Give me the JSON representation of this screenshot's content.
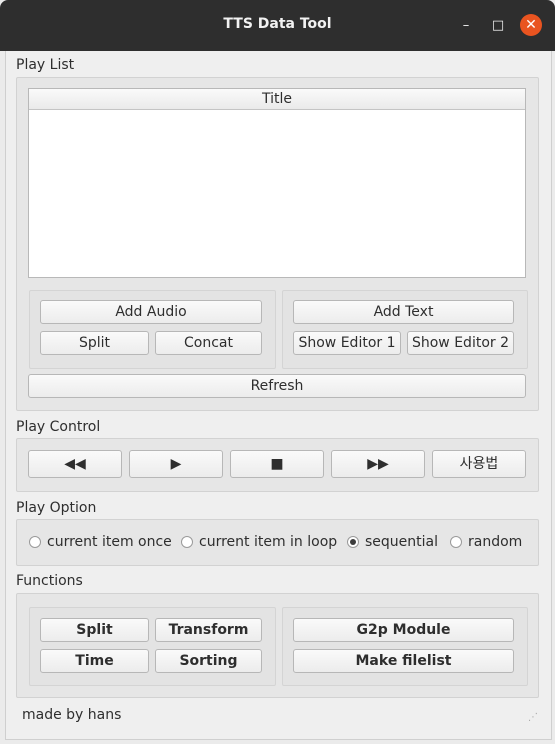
{
  "window": {
    "title": "TTS Data Tool",
    "close_symbol": "✕",
    "minimize_symbol": "–",
    "maximize_symbol": "□"
  },
  "playlist": {
    "label": "Play List",
    "column_title": "Title",
    "add_audio": "Add Audio",
    "split": "Split",
    "concat": "Concat",
    "add_text": "Add Text",
    "show_editor_1": "Show Editor 1",
    "show_editor_2": "Show Editor 2",
    "refresh": "Refresh"
  },
  "play_control": {
    "label": "Play Control",
    "rewind": "◀◀",
    "play": "▶",
    "stop": "■",
    "forward": "▶▶",
    "usage": "사용법"
  },
  "play_option": {
    "label": "Play Option",
    "options": [
      "current item once",
      "current item in loop",
      "sequential",
      "random"
    ],
    "selected": "sequential"
  },
  "functions": {
    "label": "Functions",
    "split": "Split",
    "transform": "Transform",
    "time": "Time",
    "sorting": "Sorting",
    "g2p": "G2p Module",
    "make_filelist": "Make filelist"
  },
  "footer": {
    "text": "made by hans"
  },
  "colors": {
    "titlebar": "#2e2e2e",
    "close": "#e95420",
    "window": "#efefef"
  }
}
